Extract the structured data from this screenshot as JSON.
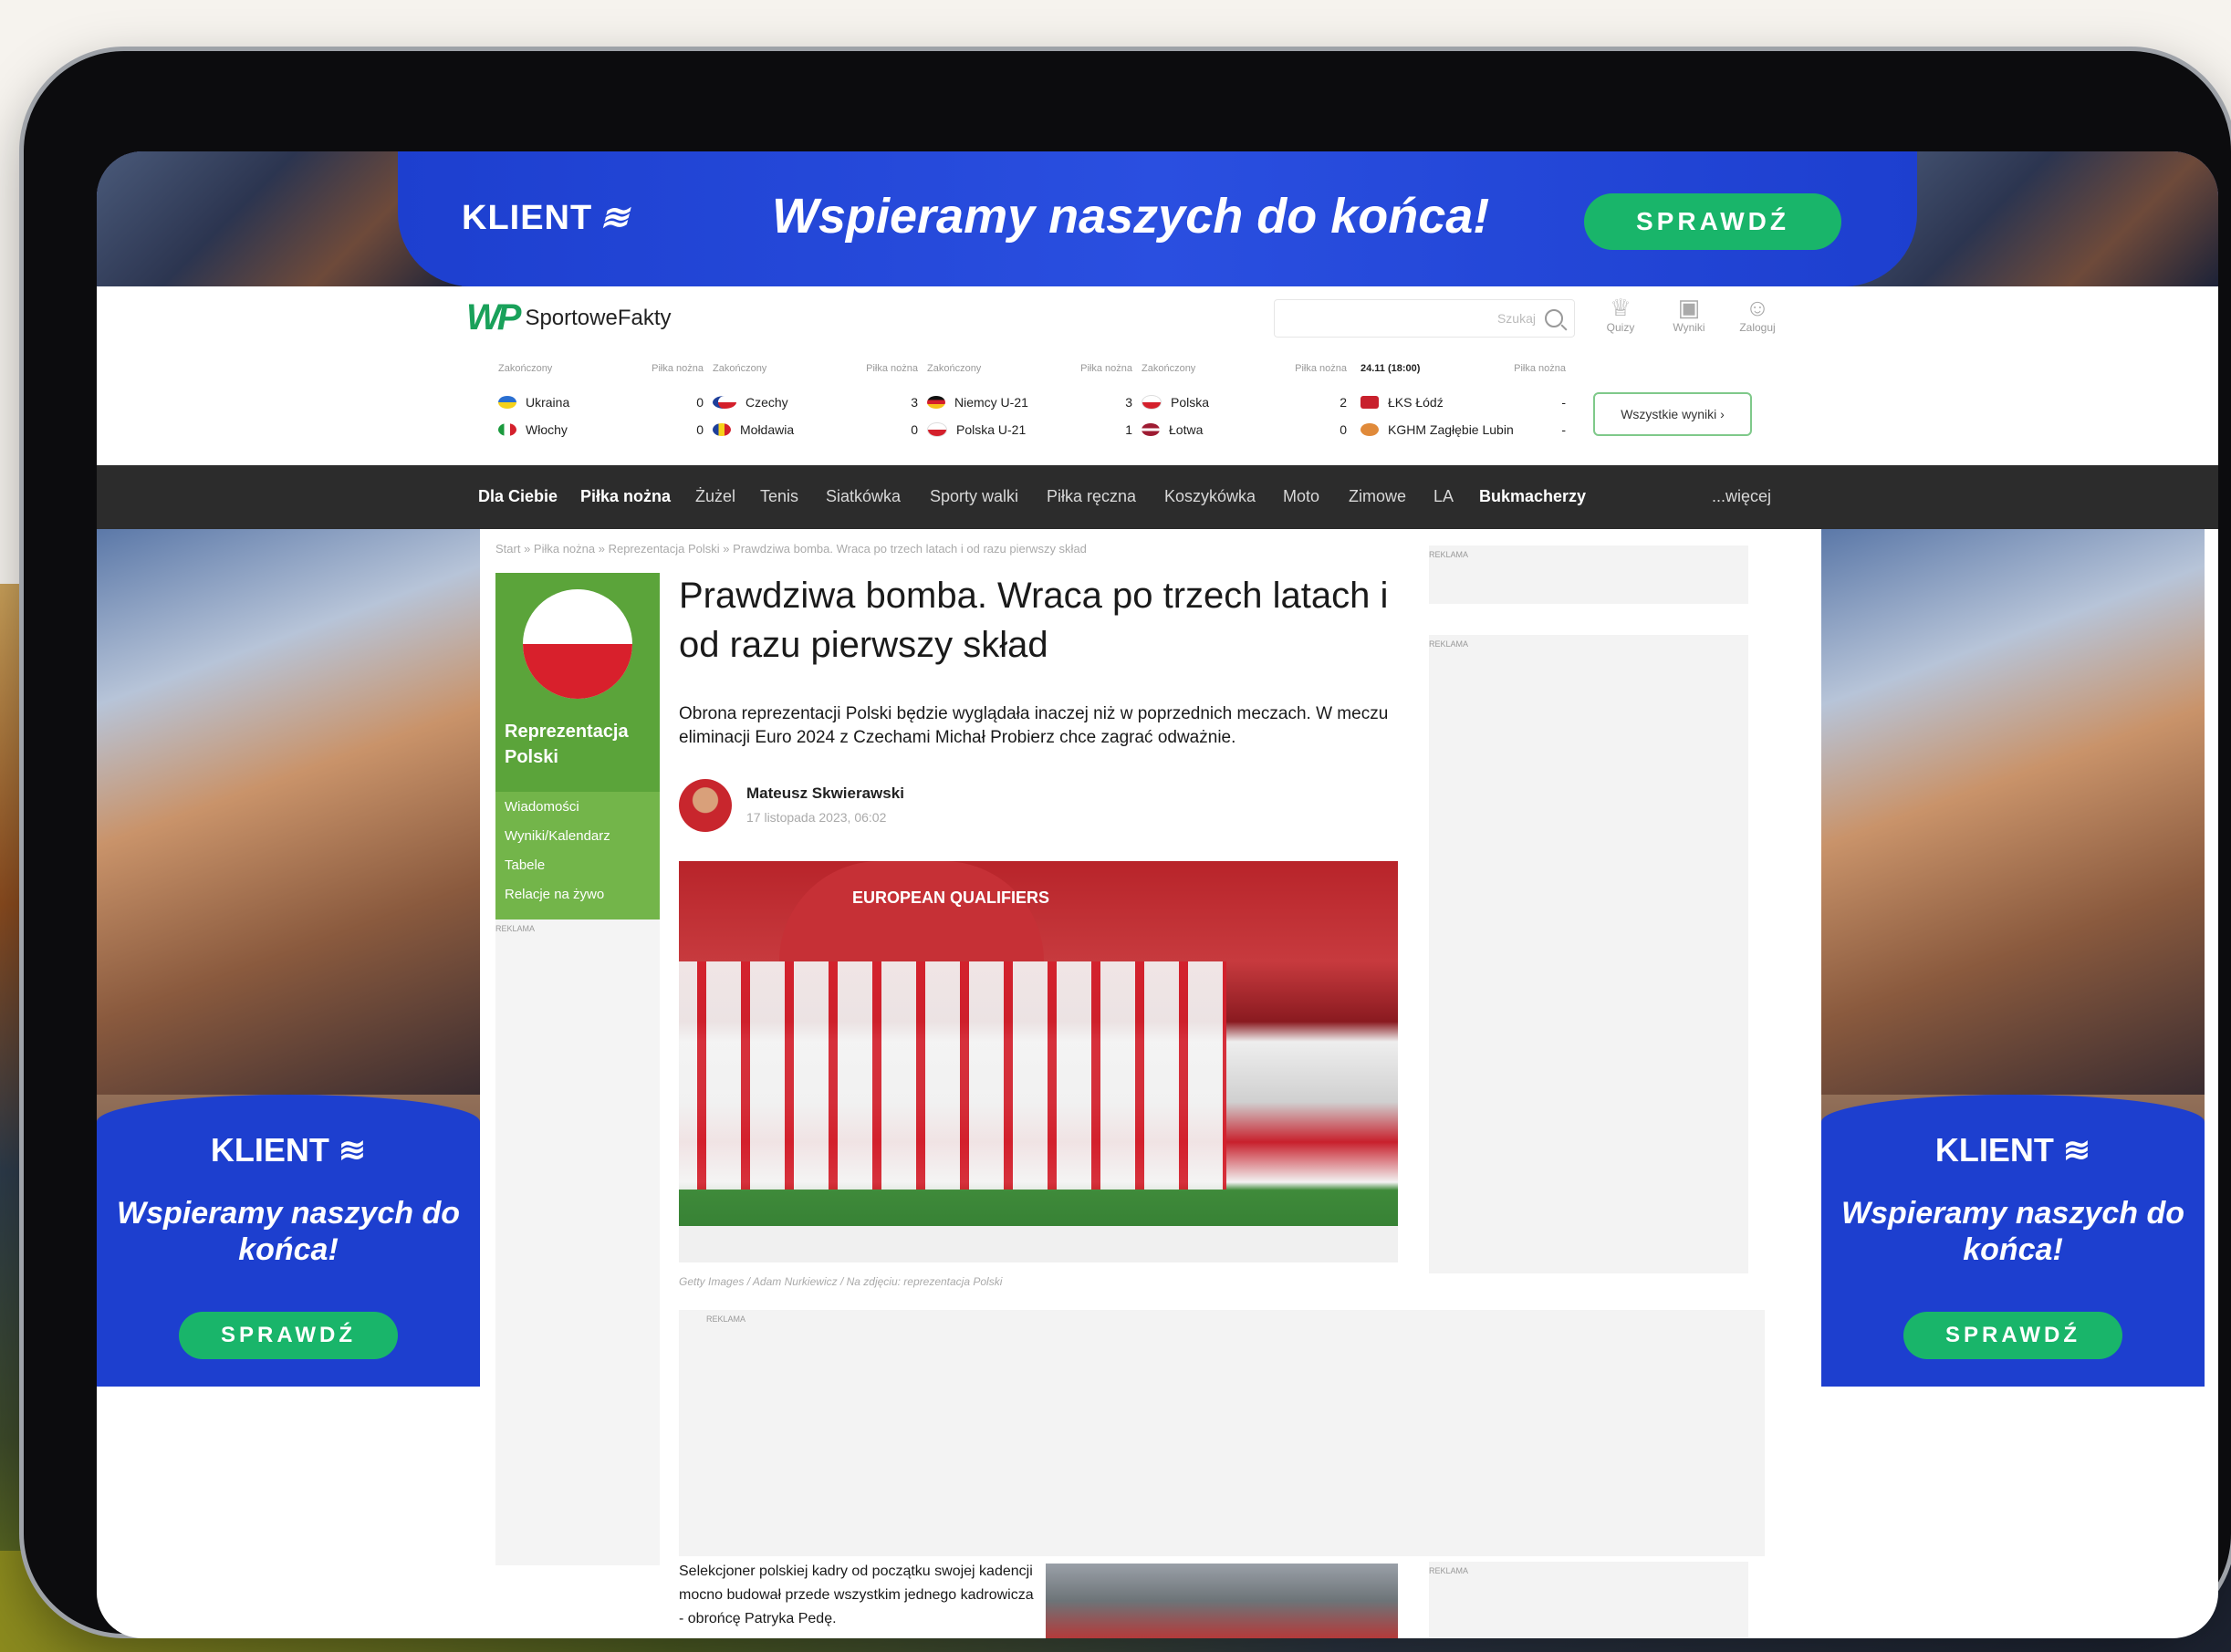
{
  "banner": {
    "brand": "KLIENT",
    "slogan": "Wspieramy naszych do końca!",
    "button": "SPRAWDŹ"
  },
  "header": {
    "logo_text": "SportoweFakty",
    "search_placeholder": "Szukaj",
    "icons": [
      {
        "label": "Quizy",
        "icon": "trophy-icon"
      },
      {
        "label": "Wyniki",
        "icon": "scoreboard-icon"
      },
      {
        "label": "Zaloguj",
        "icon": "user-icon"
      }
    ]
  },
  "scores": {
    "matches": [
      {
        "status": "Zakończony",
        "sport": "Piłka nożna",
        "home": "Ukraina",
        "home_score": "0",
        "away": "Włochy",
        "away_score": "0"
      },
      {
        "status": "Zakończony",
        "sport": "Piłka nożna",
        "home": "Czechy",
        "home_score": "3",
        "away": "Mołdawia",
        "away_score": "0"
      },
      {
        "status": "Zakończony",
        "sport": "Piłka nożna",
        "home": "Niemcy U-21",
        "home_score": "3",
        "away": "Polska U-21",
        "away_score": "1"
      },
      {
        "status": "Zakończony",
        "sport": "Piłka nożna",
        "home": "Polska",
        "home_score": "2",
        "away": "Łotwa",
        "away_score": "0"
      },
      {
        "status": "24.11 (18:00)",
        "sport": "Piłka nożna",
        "home": "ŁKS Łódź",
        "home_score": "-",
        "away": "KGHM Zagłębie Lubin",
        "away_score": "-"
      }
    ],
    "all_results": "Wszystkie wyniki ›"
  },
  "nav": {
    "items": [
      "Dla Ciebie",
      "Piłka nożna",
      "Żużel",
      "Tenis",
      "Siatkówka",
      "Sporty walki",
      "Piłka ręczna",
      "Koszykówka",
      "Moto",
      "Zimowe",
      "LA",
      "Bukmacherzy"
    ],
    "more": "...więcej"
  },
  "breadcrumb": "Start  »  Piłka nożna  »  Reprezentacja Polski  »  Prawdziwa bomba. Wraca po trzech latach i od razu pierwszy skład",
  "category": {
    "title": "Reprezentacja Polski",
    "menu": [
      "Wiadomości",
      "Wyniki/Kalendarz",
      "Tabele",
      "Relacje na żywo"
    ]
  },
  "ad_label": "REKLAMA",
  "article": {
    "title": "Prawdziwa bomba. Wraca po trzech latach i od razu pierwszy skład",
    "lead": "Obrona reprezentacji Polski będzie wyglądała inaczej niż w poprzednich meczach. W meczu eliminacji Euro 2024 z Czechami Michał Probierz chce zagrać odważnie.",
    "author": "Mateusz Skwierawski",
    "date": "17 listopada 2023, 06:02",
    "image_text": "EUROPEAN QUALIFIERS",
    "caption": "Getty Images / Adam Nurkiewicz / Na zdjęciu: reprezentacja Polski",
    "body": "Selekcjoner polskiej kadry od początku swojej kadencji mocno budował przede wszystkim jednego kadrowicza - obrońcę Patryka Pedę."
  },
  "colors": {
    "banner_blue": "#1d3fcf",
    "cta_green": "#19b56a",
    "category_green": "#5ba43a",
    "nav_dark": "#2c2c2c"
  }
}
